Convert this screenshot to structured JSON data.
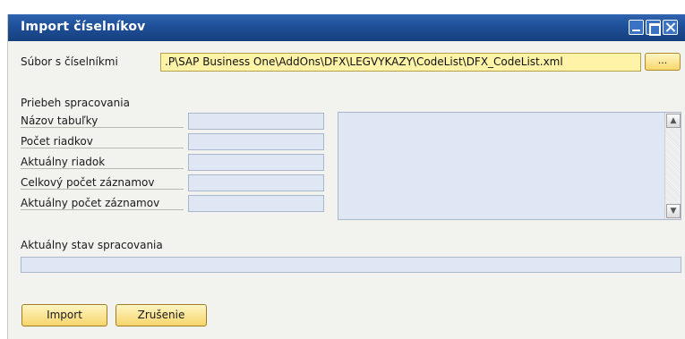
{
  "window": {
    "title": "Import číselníkov"
  },
  "file": {
    "label": "Súbor s číselníkmi",
    "value": ".P\\SAP Business One\\AddOns\\DFX\\LEGVYKAZY\\CodeList\\DFX_CodeList.xml",
    "browse_label": "..."
  },
  "progress_section": {
    "heading": "Priebeh spracovania",
    "fields": [
      {
        "label": "Názov tabuľky",
        "value": ""
      },
      {
        "label": "Počet riadkov",
        "value": ""
      },
      {
        "label": "Aktuálny riadok",
        "value": ""
      },
      {
        "label": "Celkový počet záznamov",
        "value": ""
      },
      {
        "label": "Aktuálny počet záznamov",
        "value": ""
      }
    ],
    "status_label": "Aktuálny stav spracovania"
  },
  "buttons": {
    "import": "Import",
    "cancel": "Zrušenie"
  }
}
